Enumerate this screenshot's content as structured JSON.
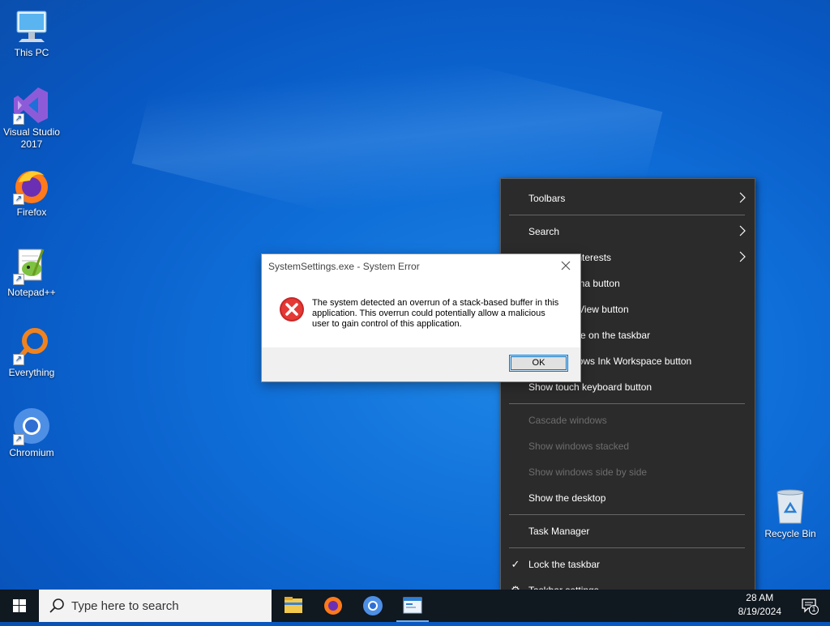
{
  "desktop": {
    "icons": [
      {
        "label": "This PC"
      },
      {
        "label": "Visual Studio 2017"
      },
      {
        "label": "Firefox"
      },
      {
        "label": "Notepad++"
      },
      {
        "label": "Everything"
      },
      {
        "label": "Chromium"
      },
      {
        "label": "Recycle Bin"
      }
    ]
  },
  "context_menu": {
    "items": [
      {
        "label": "Toolbars",
        "submenu": true,
        "enabled": true
      },
      {
        "label": "Search",
        "submenu": true,
        "enabled": true
      },
      {
        "label": "News and interests",
        "submenu": true,
        "enabled": true
      },
      {
        "label": "Show Cortana button",
        "enabled": true
      },
      {
        "label": "Show Task View button",
        "enabled": true
      },
      {
        "label": "Show People on the taskbar",
        "enabled": true
      },
      {
        "label": "Show Windows Ink Workspace button",
        "enabled": true
      },
      {
        "label": "Show touch keyboard button",
        "enabled": true
      },
      {
        "label": "Cascade windows",
        "enabled": false
      },
      {
        "label": "Show windows stacked",
        "enabled": false
      },
      {
        "label": "Show windows side by side",
        "enabled": false
      },
      {
        "label": "Show the desktop",
        "enabled": true
      },
      {
        "label": "Task Manager",
        "enabled": true
      },
      {
        "label": "Lock the taskbar",
        "checked": true,
        "enabled": true
      },
      {
        "label": "Taskbar settings",
        "icon": "gear-icon",
        "enabled": true
      }
    ]
  },
  "dialog": {
    "title": "SystemSettings.exe - System Error",
    "message": "The system detected an overrun of a stack-based buffer in this application. This overrun could potentially allow a malicious user to gain control of this application.",
    "ok_label": "OK",
    "icon": "error-icon"
  },
  "taskbar": {
    "search_placeholder": "Type here to search",
    "apps": [
      "file-explorer-icon",
      "firefox-icon",
      "chromium-icon",
      "app-window-icon"
    ],
    "time": "28 AM",
    "date": "8/19/2024",
    "notification_count": "1"
  },
  "colors": {
    "menu_bg": "#2b2b2b",
    "menu_disabled": "#6d6d6d",
    "taskbar_bg": "#101820",
    "error_red": "#d32f2f",
    "accent": "#0078d7"
  }
}
